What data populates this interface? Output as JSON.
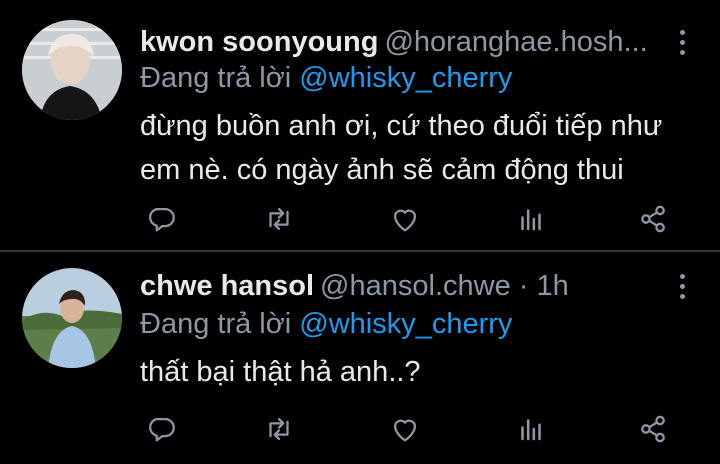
{
  "tweets": [
    {
      "name": "kwon soonyoung",
      "handle": "@horanghae.hosh...",
      "replying_prefix": "Đang trả lời",
      "replying_to": "@whisky_cherry",
      "text_line1": "đừng buồn anh ơi, cứ theo đuổi tiếp như",
      "text_line2": "em nè. có ngày ảnh sẽ cảm động thui",
      "icons": [
        "reply-icon",
        "retweet-icon",
        "like-icon",
        "analytics-icon",
        "share-icon",
        "more-icon"
      ]
    },
    {
      "name": "chwe hansol",
      "handle": "@hansol.chwe",
      "dot": " · ",
      "time": "1h",
      "replying_prefix": "Đang trả lời",
      "replying_to": "@whisky_cherry",
      "text_line1": "thất bại thật hả anh..?",
      "icons": [
        "reply-icon",
        "retweet-icon",
        "like-icon",
        "analytics-icon",
        "share-icon",
        "more-icon"
      ]
    }
  ],
  "colors": {
    "background": "#000000",
    "text": "#e7e9ea",
    "secondary": "#8b98a5",
    "mention": "#1d9bf0",
    "divider": "#2f3336"
  }
}
